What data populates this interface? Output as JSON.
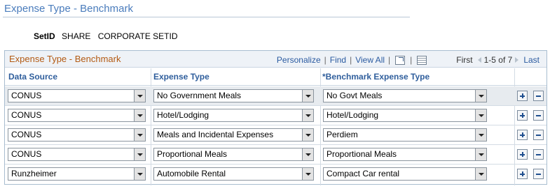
{
  "page": {
    "title": "Expense Type - Benchmark"
  },
  "setid": {
    "label": "SetID",
    "value": "SHARE",
    "description": "CORPORATE SETID"
  },
  "grid": {
    "title": "Expense Type - Benchmark",
    "nav": {
      "personalize": "Personalize",
      "find": "Find",
      "view_all": "View All",
      "first": "First",
      "range": "1-5 of 7",
      "last": "Last",
      "zoom_icon": "zoom-grid-icon",
      "download_icon": "download-spreadsheet-icon"
    },
    "columns": [
      "Data Source",
      "Expense Type",
      "*Benchmark Expense Type"
    ],
    "rows": [
      {
        "data_source": "CONUS",
        "expense_type": "No Government Meals",
        "benchmark": "No Govt Meals"
      },
      {
        "data_source": "CONUS",
        "expense_type": "Hotel/Lodging",
        "benchmark": "Hotel/Lodging"
      },
      {
        "data_source": "CONUS",
        "expense_type": "Meals and Incidental Expenses",
        "benchmark": "Perdiem"
      },
      {
        "data_source": "CONUS",
        "expense_type": "Proportional Meals",
        "benchmark": "Proportional Meals"
      },
      {
        "data_source": "Runzheimer",
        "expense_type": "Automobile Rental",
        "benchmark": "Compact Car rental"
      }
    ]
  },
  "colors": {
    "title_blue": "#4a7cbc",
    "grid_title_orange": "#b35a13",
    "link_blue": "#2a5aa0",
    "first_row_bg": "#e7ebef"
  }
}
